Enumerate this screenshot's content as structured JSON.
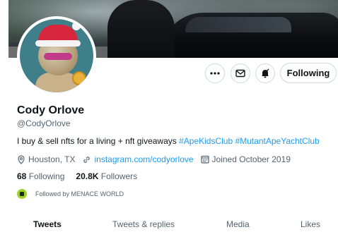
{
  "profile": {
    "name": "Cody Orlove",
    "handle": "@CodyOrlove",
    "bio_text": "I buy & sell nfts for a living + nft giveaways ",
    "bio_tags": [
      "#ApeKidsClub",
      "#MutantApeYachtClub"
    ],
    "location": "Houston, TX",
    "website": "instagram.com/codyorlove",
    "joined": "Joined October 2019"
  },
  "stats": {
    "following_count": "68",
    "following_label": "Following",
    "followers_count": "20.8K",
    "followers_label": "Followers"
  },
  "followed_by": "Followed by MENACE WORLD",
  "actions": {
    "more_icon": "more-icon",
    "message_icon": "mail-icon",
    "notify_icon": "bell-icon",
    "following_label": "Following"
  },
  "tabs": [
    {
      "label": "Tweets",
      "active": true
    },
    {
      "label": "Tweets & replies",
      "active": false
    },
    {
      "label": "Media",
      "active": false
    },
    {
      "label": "Likes",
      "active": false
    }
  ],
  "colors": {
    "accent": "#1d9bf0",
    "text_primary": "#0f1419",
    "text_secondary": "#536471",
    "border": "#cfd9de"
  }
}
